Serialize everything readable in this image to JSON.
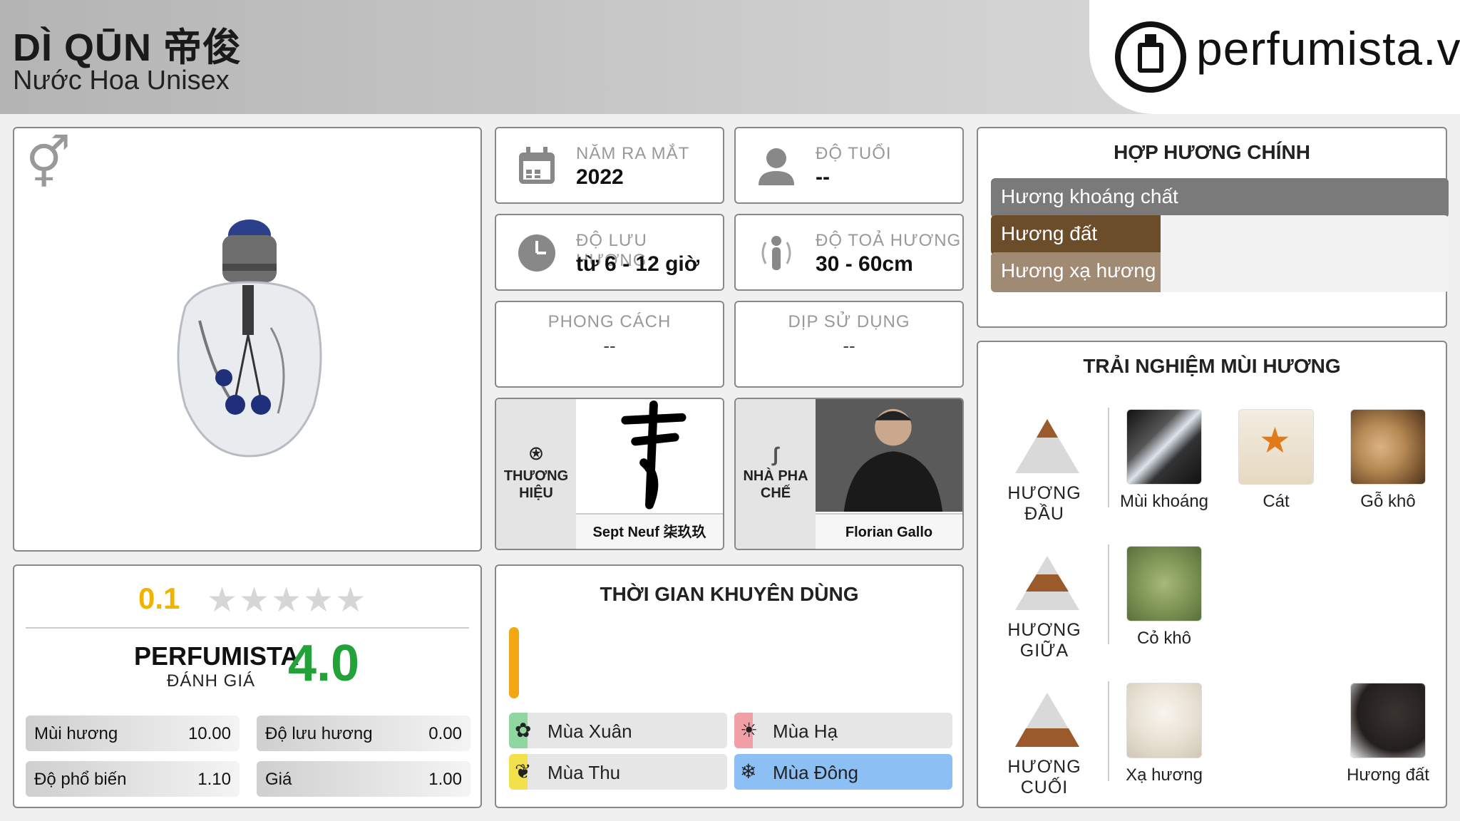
{
  "header": {
    "title": "DÌ QŪN 帝俊",
    "subtitle": "Nước Hoa Unisex",
    "logo_text": "perfumista.vn"
  },
  "image_panel": {
    "gender_icon": "unisex-icon"
  },
  "info": {
    "year": {
      "label": "NĂM RA MẮT",
      "value": "2022",
      "icon": "calendar-icon"
    },
    "age": {
      "label": "ĐỘ TUỔI",
      "value": "--",
      "icon": "person-icon"
    },
    "longevity": {
      "label": "ĐỘ LƯU HƯƠNG",
      "value": "từ 6 - 12 giờ",
      "icon": "clock-icon"
    },
    "sillage": {
      "label": "ĐỘ TOẢ HƯƠNG",
      "value": "30 - 60cm",
      "icon": "sillage-icon"
    },
    "style": {
      "label": "PHONG CÁCH",
      "value": "--"
    },
    "occasion": {
      "label": "DỊP SỬ DỤNG",
      "value": "--"
    },
    "brand": {
      "label_line1": "THƯƠNG",
      "label_line2": "HIỆU",
      "name": "Sept Neuf 柒玖玖",
      "icon": "star-badge-icon"
    },
    "perfumer": {
      "label_line1": "NHÀ PHA",
      "label_line2": "CHẾ",
      "name": "Florian Gallo",
      "icon": "nose-icon"
    }
  },
  "accords": {
    "title": "HỢP HƯƠNG CHÍNH",
    "items": [
      {
        "label": "Hương khoáng chất",
        "level": 1.0,
        "color": "#7a7a7a"
      },
      {
        "label": "Hương đất",
        "level": 0.37,
        "color": "#6b4d2a"
      },
      {
        "label": "Hương xạ hương",
        "level": 0.37,
        "color": "#a08a73"
      }
    ]
  },
  "rating": {
    "user_score": "0.1",
    "stars_filled": 0.02,
    "perfumista_title": "PERFUMISTA",
    "perfumista_sub": "ĐÁNH GIÁ",
    "perfumista_score": "4.0",
    "metrics": [
      {
        "label": "Mùi hương",
        "value": "10.00"
      },
      {
        "label": "Độ lưu hương",
        "value": "0.00"
      },
      {
        "label": "Độ phổ biến",
        "value": "1.10"
      },
      {
        "label": "Giá",
        "value": "1.00"
      }
    ]
  },
  "time": {
    "title": "THỜI GIAN KHUYÊN DÙNG",
    "day_level": 1.0,
    "seasons": [
      {
        "label": "Mùa Xuân",
        "icon": "flower-icon",
        "color": "#8fd6a0",
        "active": false
      },
      {
        "label": "Mùa Hạ",
        "icon": "sun-icon",
        "color": "#f2a0a8",
        "active": false
      },
      {
        "label": "Mùa Thu",
        "icon": "leaf-icon",
        "color": "#f2e14a",
        "active": false
      },
      {
        "label": "Mùa Đông",
        "icon": "snowflake-icon",
        "color": "#8cc0f5",
        "active": true
      }
    ]
  },
  "notes": {
    "title": "TRẢI NGHIỆM MÙI HƯƠNG",
    "top": {
      "label": "HƯƠNG ĐẦU",
      "items": [
        "Mùi khoáng",
        "Cát",
        "Gỗ khô"
      ]
    },
    "middle": {
      "label": "HƯƠNG GIỮA",
      "items": [
        "Cỏ khô"
      ]
    },
    "base": {
      "label": "HƯƠNG CUỐI",
      "items": [
        "Xạ hương",
        "Hương đất"
      ]
    }
  }
}
